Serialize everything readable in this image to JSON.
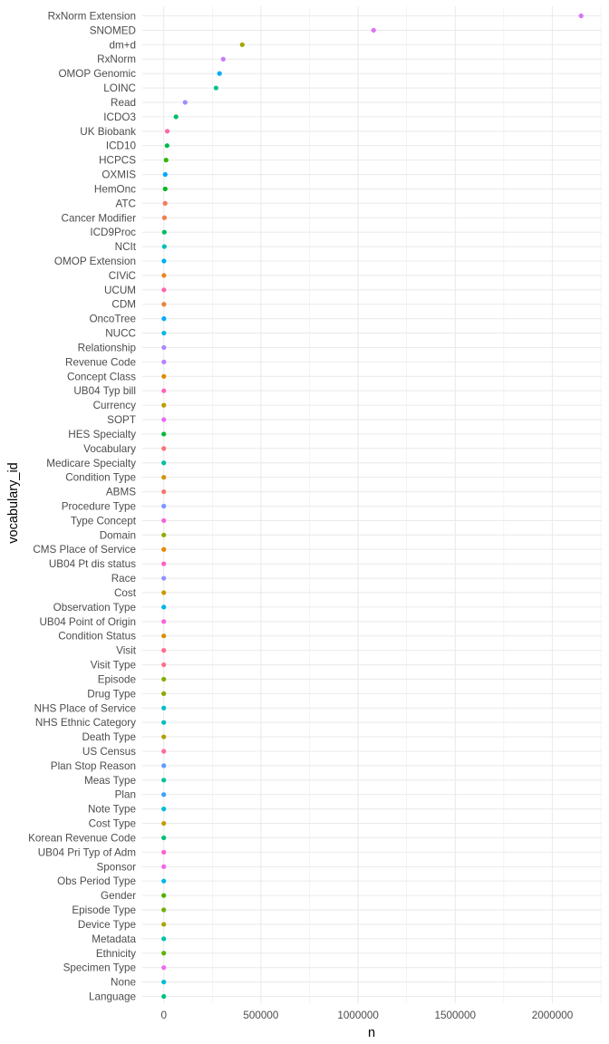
{
  "chart_data": {
    "type": "scatter",
    "title": "",
    "xlabel": "n",
    "ylabel": "vocabulary_id",
    "xlim": [
      -100000,
      2250000
    ],
    "x_ticks": [
      0,
      500000,
      1000000,
      1500000,
      2000000
    ],
    "x_tick_labels": [
      "0",
      "500000",
      "1000000",
      "1500000",
      "2000000"
    ],
    "grid": true,
    "legend": "none",
    "color_by": "vocabulary_id",
    "points": [
      {
        "label": "RxNorm Extension",
        "n": 2148000
      },
      {
        "label": "SNOMED",
        "n": 1080000
      },
      {
        "label": "dm+d",
        "n": 404000
      },
      {
        "label": "RxNorm",
        "n": 306000
      },
      {
        "label": "OMOP Genomic",
        "n": 287000
      },
      {
        "label": "LOINC",
        "n": 269000
      },
      {
        "label": "Read",
        "n": 110000
      },
      {
        "label": "ICDO3",
        "n": 63000
      },
      {
        "label": "UK Biobank",
        "n": 18000
      },
      {
        "label": "ICD10",
        "n": 17000
      },
      {
        "label": "HCPCS",
        "n": 12000
      },
      {
        "label": "OXMIS",
        "n": 7500
      },
      {
        "label": "HemOnc",
        "n": 7500
      },
      {
        "label": "ATC",
        "n": 7000
      },
      {
        "label": "Cancer Modifier",
        "n": 3500
      },
      {
        "label": "ICD9Proc",
        "n": 3000
      },
      {
        "label": "NCIt",
        "n": 3000
      },
      {
        "label": "OMOP Extension",
        "n": 1000
      },
      {
        "label": "CIViC",
        "n": 900
      },
      {
        "label": "UCUM",
        "n": 900
      },
      {
        "label": "CDM",
        "n": 800
      },
      {
        "label": "OncoTree",
        "n": 800
      },
      {
        "label": "NUCC",
        "n": 800
      },
      {
        "label": "Relationship",
        "n": 700
      },
      {
        "label": "Revenue Code",
        "n": 600
      },
      {
        "label": "Concept Class",
        "n": 500
      },
      {
        "label": "UB04 Typ bill",
        "n": 500
      },
      {
        "label": "Currency",
        "n": 200
      },
      {
        "label": "SOPT",
        "n": 200
      },
      {
        "label": "HES Specialty",
        "n": 100
      },
      {
        "label": "Vocabulary",
        "n": 100
      },
      {
        "label": "Medicare Specialty",
        "n": 100
      },
      {
        "label": "Condition Type",
        "n": 100
      },
      {
        "label": "ABMS",
        "n": 100
      },
      {
        "label": "Procedure Type",
        "n": 100
      },
      {
        "label": "Type Concept",
        "n": 100
      },
      {
        "label": "Domain",
        "n": 50
      },
      {
        "label": "CMS Place of Service",
        "n": 50
      },
      {
        "label": "UB04 Pt dis status",
        "n": 50
      },
      {
        "label": "Race",
        "n": 50
      },
      {
        "label": "Cost",
        "n": 50
      },
      {
        "label": "Observation Type",
        "n": 50
      },
      {
        "label": "UB04 Point of Origin",
        "n": 20
      },
      {
        "label": "Condition Status",
        "n": 20
      },
      {
        "label": "Visit",
        "n": 20
      },
      {
        "label": "Visit Type",
        "n": 20
      },
      {
        "label": "Episode",
        "n": 20
      },
      {
        "label": "Drug Type",
        "n": 20
      },
      {
        "label": "NHS Place of Service",
        "n": 20
      },
      {
        "label": "NHS Ethnic Category",
        "n": 20
      },
      {
        "label": "Death Type",
        "n": 10
      },
      {
        "label": "US Census",
        "n": 10
      },
      {
        "label": "Plan Stop Reason",
        "n": 10
      },
      {
        "label": "Meas Type",
        "n": 10
      },
      {
        "label": "Plan",
        "n": 10
      },
      {
        "label": "Note Type",
        "n": 10
      },
      {
        "label": "Cost Type",
        "n": 10
      },
      {
        "label": "Korean Revenue Code",
        "n": 10
      },
      {
        "label": "UB04 Pri Typ of Adm",
        "n": 10
      },
      {
        "label": "Sponsor",
        "n": 5
      },
      {
        "label": "Obs Period Type",
        "n": 5
      },
      {
        "label": "Gender",
        "n": 5
      },
      {
        "label": "Episode Type",
        "n": 5
      },
      {
        "label": "Device Type",
        "n": 5
      },
      {
        "label": "Metadata",
        "n": 5
      },
      {
        "label": "Ethnicity",
        "n": 5
      },
      {
        "label": "Specimen Type",
        "n": 5
      },
      {
        "label": "None",
        "n": 1
      },
      {
        "label": "Language",
        "n": 1
      }
    ]
  }
}
